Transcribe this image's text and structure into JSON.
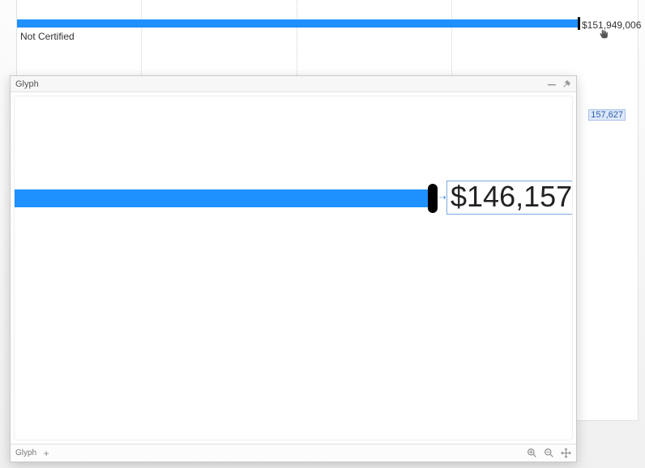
{
  "chart_data": {
    "type": "bar",
    "categories": [
      "Not Certified"
    ],
    "values": [
      151949006
    ],
    "title": "",
    "xlabel": "",
    "ylabel": "",
    "orientation": "horizontal"
  },
  "background": {
    "bar_label": "Not Certified",
    "bar_value": "$151,949,006",
    "partial_value": "157,627"
  },
  "panel": {
    "title": "Glyph",
    "footer_label": "Glyph",
    "preview": {
      "value": "$146,157"
    }
  }
}
